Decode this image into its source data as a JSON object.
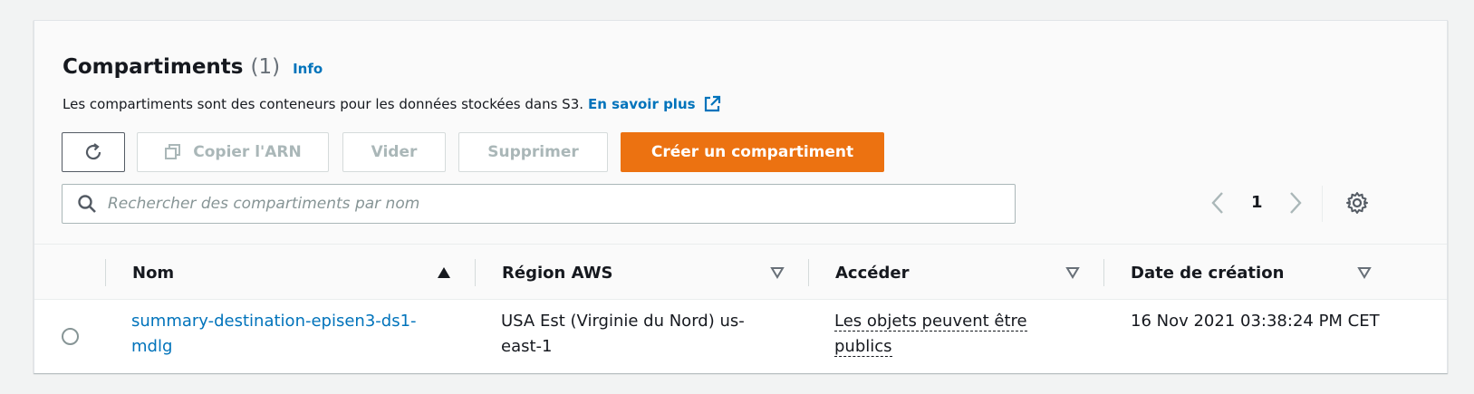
{
  "section": {
    "title": "Compartiments",
    "count": "(1)",
    "info_link": "Info",
    "description": "Les compartiments sont des conteneurs pour les données stockées dans S3.",
    "learn_more": "En savoir plus"
  },
  "toolbar": {
    "copy_arn_label": "Copier l'ARN",
    "empty_label": "Vider",
    "delete_label": "Supprimer",
    "create_label": "Créer un compartiment",
    "create_color": "#ec7211"
  },
  "search": {
    "placeholder": "Rechercher des compartiments par nom",
    "value": ""
  },
  "pagination": {
    "current_page": "1"
  },
  "table": {
    "columns": [
      {
        "label": "Nom",
        "sort": "ascending"
      },
      {
        "label": "Région AWS",
        "sort": "none"
      },
      {
        "label": "Accéder",
        "sort": "none"
      },
      {
        "label": "Date de création",
        "sort": "none"
      }
    ],
    "rows": [
      {
        "name": "summary-destination-episen3-ds1-mdlg",
        "region": "USA Est (Virginie du Nord) us-east-1",
        "access": "Les objets peuvent être publics",
        "created": "16 Nov 2021 03:38:24 PM CET",
        "selected": false
      }
    ]
  },
  "icons": [
    "refresh-icon",
    "copy-icon",
    "external-link-icon",
    "search-icon",
    "chevron-left-icon",
    "chevron-right-icon",
    "gear-icon",
    "sort-ascending-icon",
    "sort-descending-icon"
  ]
}
